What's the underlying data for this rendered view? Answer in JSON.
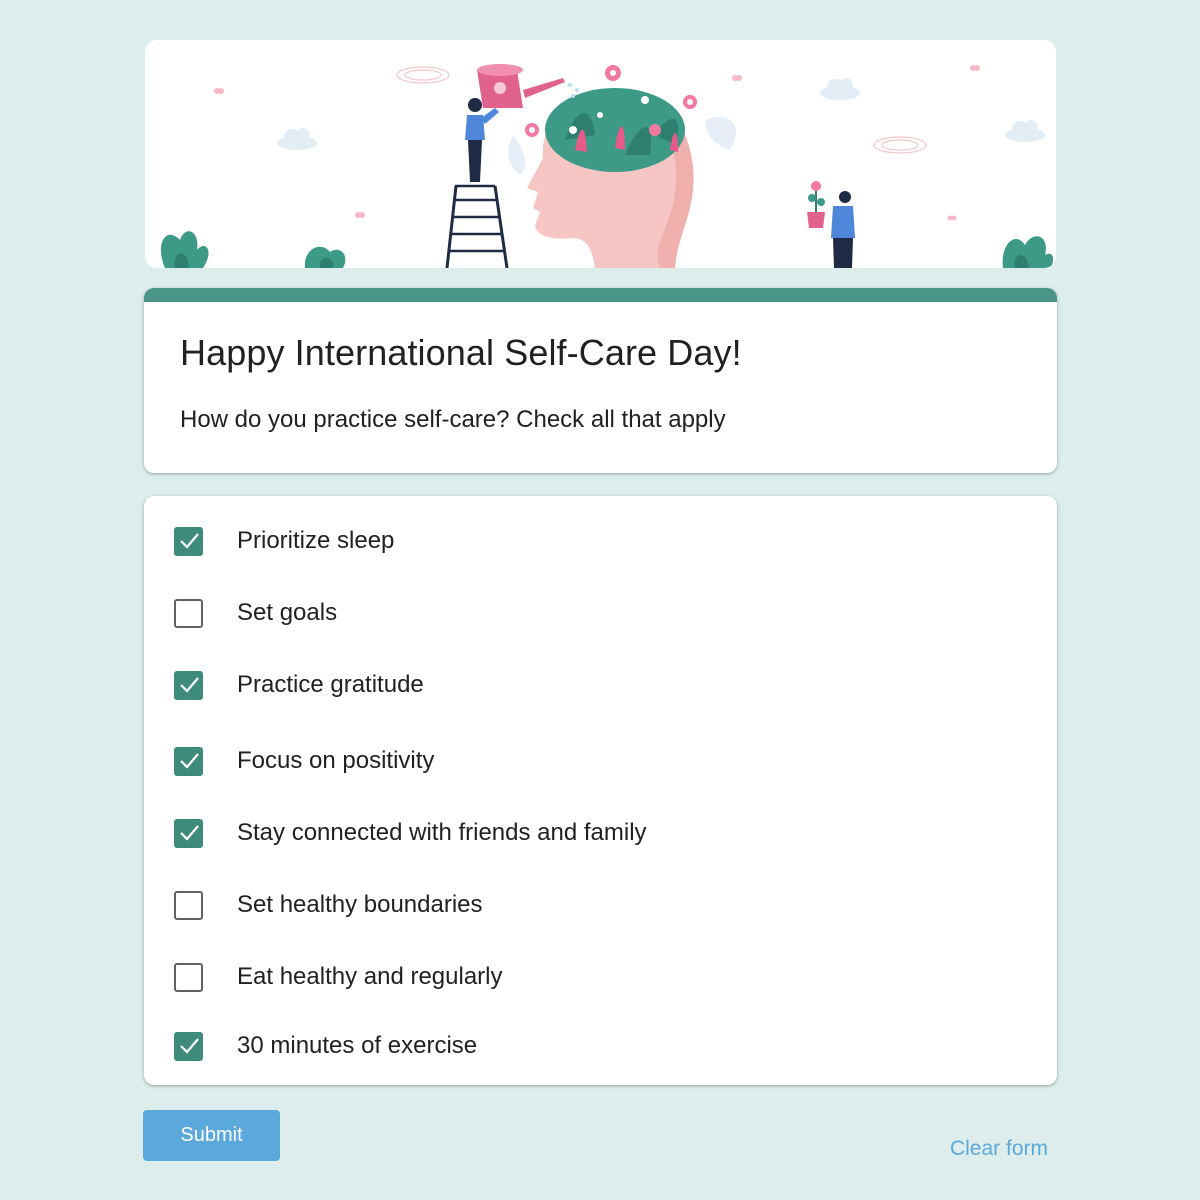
{
  "form": {
    "title": "Happy International Self-Care Day!",
    "description": "How do you practice self-care? Check all that apply",
    "accent_color": "#4a9587",
    "checkbox_color": "#3f8b7b"
  },
  "options": [
    {
      "label": "Prioritize sleep",
      "checked": true
    },
    {
      "label": "Set goals",
      "checked": false
    },
    {
      "label": "Practice gratitude",
      "checked": true
    },
    {
      "label": "Focus on positivity",
      "checked": true
    },
    {
      "label": "Stay connected with friends and family",
      "checked": true
    },
    {
      "label": "Set healthy boundaries",
      "checked": false
    },
    {
      "label": "Eat healthy and regularly",
      "checked": false
    },
    {
      "label": "30 minutes of exercise",
      "checked": true
    }
  ],
  "actions": {
    "submit_label": "Submit",
    "submit_color": "#5ba9dc",
    "clear_label": "Clear form"
  },
  "banner": {
    "illustration": "head-with-flower-garden-watering-can-illustration"
  }
}
